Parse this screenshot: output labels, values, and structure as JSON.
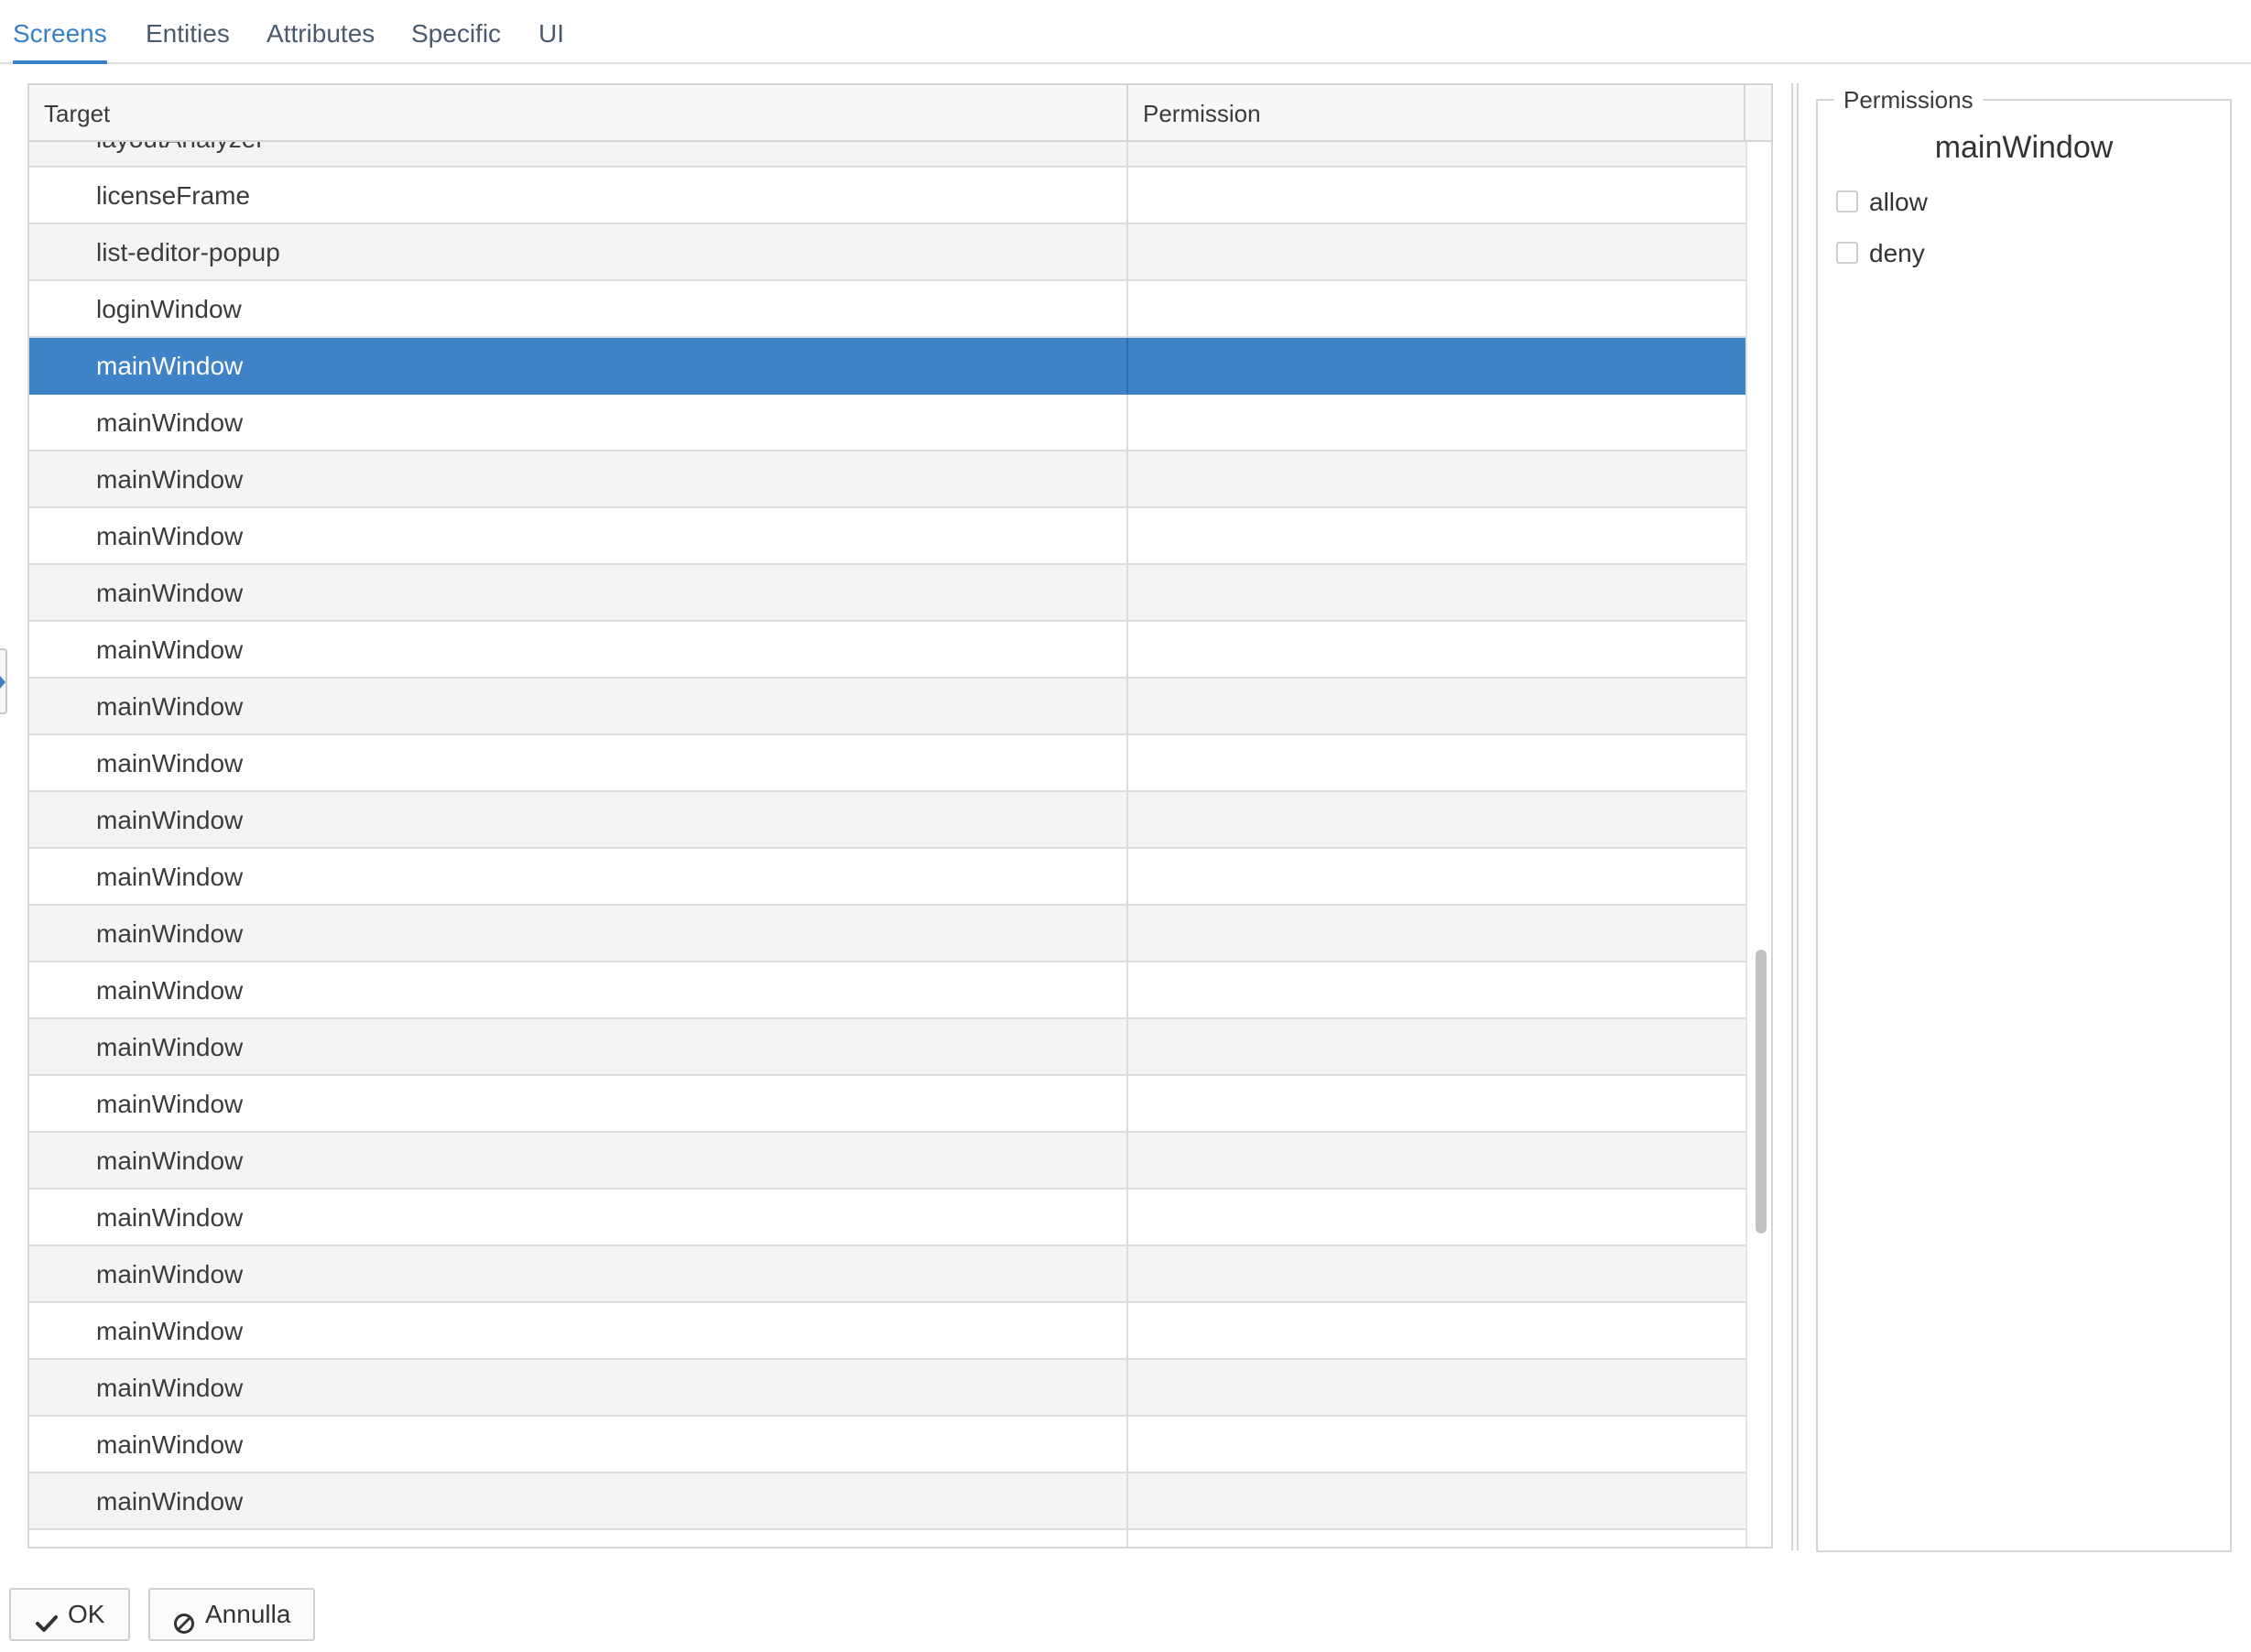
{
  "tabs": [
    {
      "label": "Screens",
      "active": true
    },
    {
      "label": "Entities",
      "active": false
    },
    {
      "label": "Attributes",
      "active": false
    },
    {
      "label": "Specific",
      "active": false
    },
    {
      "label": "UI",
      "active": false
    }
  ],
  "table": {
    "columns": {
      "target": "Target",
      "permission": "Permission"
    },
    "rows": [
      {
        "target": "layoutAnalyzer",
        "permission": ""
      },
      {
        "target": "licenseFrame",
        "permission": ""
      },
      {
        "target": "list-editor-popup",
        "permission": ""
      },
      {
        "target": "loginWindow",
        "permission": ""
      },
      {
        "target": "mainWindow",
        "permission": "",
        "selected": true
      },
      {
        "target": "mainWindow",
        "permission": ""
      },
      {
        "target": "mainWindow",
        "permission": ""
      },
      {
        "target": "mainWindow",
        "permission": ""
      },
      {
        "target": "mainWindow",
        "permission": ""
      },
      {
        "target": "mainWindow",
        "permission": ""
      },
      {
        "target": "mainWindow",
        "permission": ""
      },
      {
        "target": "mainWindow",
        "permission": ""
      },
      {
        "target": "mainWindow",
        "permission": ""
      },
      {
        "target": "mainWindow",
        "permission": ""
      },
      {
        "target": "mainWindow",
        "permission": ""
      },
      {
        "target": "mainWindow",
        "permission": ""
      },
      {
        "target": "mainWindow",
        "permission": ""
      },
      {
        "target": "mainWindow",
        "permission": ""
      },
      {
        "target": "mainWindow",
        "permission": ""
      },
      {
        "target": "mainWindow",
        "permission": ""
      },
      {
        "target": "mainWindow",
        "permission": ""
      },
      {
        "target": "mainWindow",
        "permission": ""
      },
      {
        "target": "mainWindow",
        "permission": ""
      },
      {
        "target": "mainWindow",
        "permission": ""
      },
      {
        "target": "mainWindow",
        "permission": ""
      },
      {
        "target": "",
        "permission": ""
      }
    ]
  },
  "permissions_panel": {
    "legend": "Permissions",
    "selected_target": "mainWindow",
    "options": [
      {
        "label": "allow",
        "checked": false
      },
      {
        "label": "deny",
        "checked": false
      }
    ]
  },
  "buttons": {
    "ok_label": "OK",
    "ok_icon": "checkmark-icon",
    "cancel_label": "Annulla",
    "cancel_icon": "ban-icon"
  },
  "colors": {
    "accent": "#3a80c6",
    "selected_row": "#3e82c7"
  }
}
